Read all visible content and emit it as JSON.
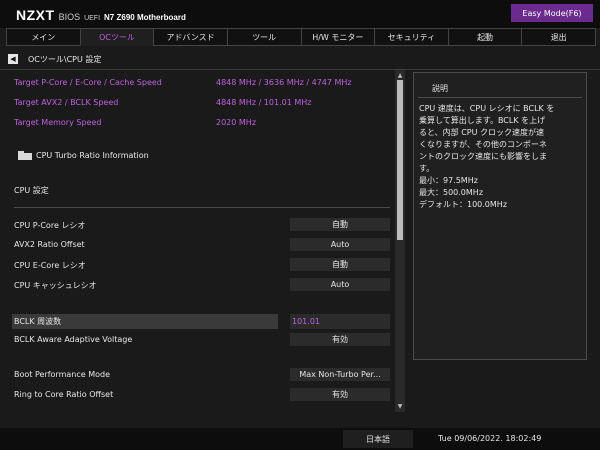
{
  "header": {
    "brand": "NZXT",
    "bios": "BIOS",
    "uefi": "UEFI",
    "model": "N7 Z690 Motherboard",
    "easy_mode": "Easy Mode(F6)"
  },
  "tabs": [
    "メイン",
    "OCツール",
    "アドバンスド",
    "ツール",
    "H/W モニター",
    "セキュリティ",
    "起動",
    "退出"
  ],
  "active_tab": "OCツール",
  "breadcrumb": "OCツール\\CPU 設定",
  "targets": [
    {
      "label": "Target P-Core / E-Core / Cache Speed",
      "value": "4848 MHz / 3636 MHz / 4747 MHz"
    },
    {
      "label": "Target AVX2 / BCLK Speed",
      "value": "4848 MHz / 101.01 MHz"
    },
    {
      "label": "Target Memory Speed",
      "value": "2020 MHz"
    }
  ],
  "submenu": "CPU Turbo Ratio Information",
  "section_title": "CPU 設定",
  "settings": [
    {
      "label": "CPU P-Core レシオ",
      "value": "自動"
    },
    {
      "label": "AVX2 Ratio Offset",
      "value": "Auto"
    },
    {
      "label": "CPU E-Core レシオ",
      "value": "自動"
    },
    {
      "label": "CPU キャッシュレシオ",
      "value": "Auto"
    },
    {
      "label": "BCLK 周波数",
      "value": "101.01"
    },
    {
      "label": "BCLK Aware Adaptive Voltage",
      "value": "有効"
    },
    {
      "label": "Boot Performance Mode",
      "value": "Max Non-Turbo Per..."
    },
    {
      "label": "Ring to Core Ratio Offset",
      "value": "有効"
    }
  ],
  "help": {
    "title": "説明",
    "body": "CPU 速度は、CPU レシオに BCLK を\n乗算して算出します。BCLK を上げ\nると、内部 CPU クロック速度が速\nくなりますが、その他のコンポーネ\nントのクロック速度にも影響をしま\nす。\n最小：97.5MHz\n最大：500.0MHz\nデフォルト：100.0MHz"
  },
  "footer": {
    "language": "日本語",
    "datetime": "Tue 09/06/2022. 18:02:49"
  },
  "colors": {
    "accent": "#c060e0",
    "easy_mode_bg": "#6a2a8e",
    "background": "#1a1a1a"
  },
  "icons": {
    "back": "back-arrow-icon",
    "folder": "folder-icon",
    "scroll_up": "scroll-up-icon",
    "scroll_down": "scroll-down-icon"
  }
}
